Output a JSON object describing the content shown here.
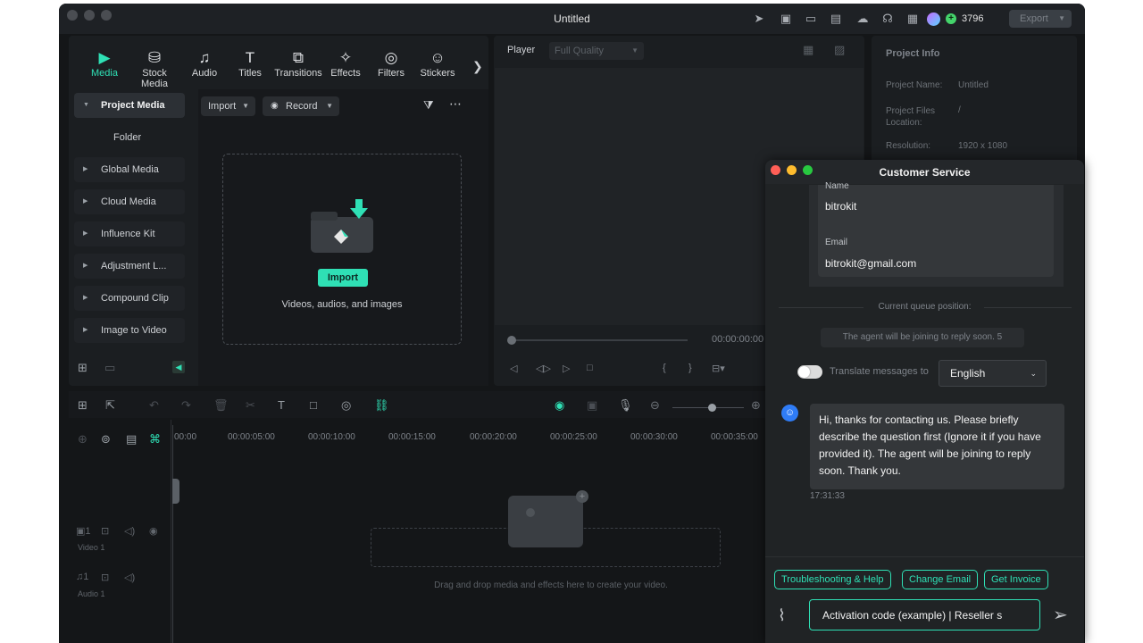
{
  "window": {
    "title": "Untitled",
    "credits": "3796",
    "export_label": "Export"
  },
  "tabs": [
    {
      "label": "Media",
      "icon": "media-icon"
    },
    {
      "label": "Stock Media",
      "icon": "stock-media-icon"
    },
    {
      "label": "Audio",
      "icon": "audio-icon"
    },
    {
      "label": "Titles",
      "icon": "titles-icon"
    },
    {
      "label": "Transitions",
      "icon": "transitions-icon"
    },
    {
      "label": "Effects",
      "icon": "effects-icon"
    },
    {
      "label": "Filters",
      "icon": "filters-icon"
    },
    {
      "label": "Stickers",
      "icon": "stickers-icon"
    }
  ],
  "sidebar": {
    "items": [
      {
        "label": "Project Media"
      },
      {
        "label": "Folder"
      },
      {
        "label": "Global Media"
      },
      {
        "label": "Cloud Media"
      },
      {
        "label": "Influence Kit"
      },
      {
        "label": "Adjustment L..."
      },
      {
        "label": "Compound Clip"
      },
      {
        "label": "Image to Video"
      }
    ]
  },
  "media": {
    "import_label": "Import",
    "record_label": "Record",
    "import_button": "Import",
    "drop_caption": "Videos, audios, and images"
  },
  "player": {
    "label": "Player",
    "quality": "Full Quality",
    "timecode": "00:00:00:00",
    "progress": 0
  },
  "project_info": {
    "title": "Project Info",
    "name_label": "Project Name:",
    "name_value": "Untitled",
    "files_label": "Project Files Location:",
    "files_value": "/",
    "resolution_label": "Resolution:",
    "resolution_value": "1920 x 1080"
  },
  "timeline": {
    "ruler": [
      "00:00",
      "00:00:05:00",
      "00:00:10:00",
      "00:00:15:00",
      "00:00:20:00",
      "00:00:25:00",
      "00:00:30:00",
      "00:00:35:00"
    ],
    "video_track": "Video 1",
    "audio_track": "Audio 1",
    "drag_caption": "Drag and drop media and effects here to create your video."
  },
  "customer_service": {
    "title": "Customer Service",
    "name_label": "Name",
    "name_value": "bitrokit",
    "email_label": "Email",
    "email_value": "bitrokit@gmail.com",
    "queue_label": "Current queue position:",
    "queue_text": "The agent will be joining to reply soon. 5",
    "translate_label": "Translate messages to",
    "language": "English",
    "agent_message": "Hi, thanks for contacting us. Please briefly describe the question first (Ignore it if you have provided it). The agent will be joining to reply soon. Thank you.",
    "message_time": "17:31:33",
    "chips": [
      "Troubleshooting & Help",
      "Change Email",
      "Get Invoice"
    ],
    "input_value": "Activation code (example) | Reseller s"
  },
  "colors": {
    "accent": "#2fe0b5",
    "background": "#141618",
    "panel": "#1b1e21"
  }
}
